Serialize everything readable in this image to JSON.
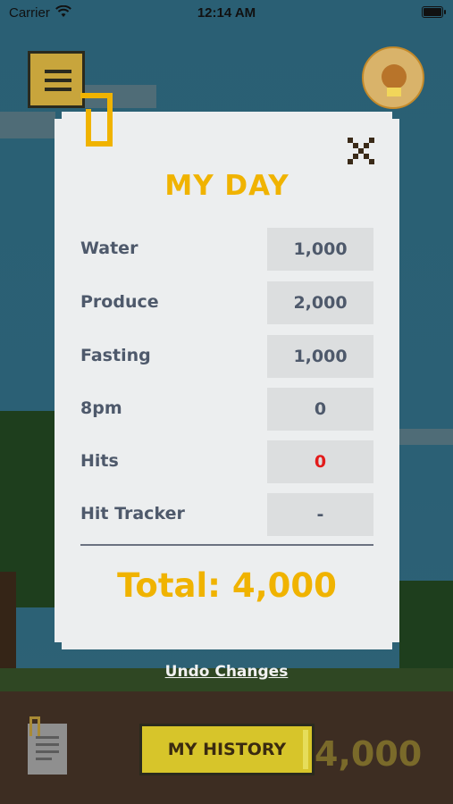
{
  "status_bar": {
    "carrier": "Carrier",
    "time": "12:14 AM"
  },
  "modal": {
    "title": "MY DAY",
    "rows": [
      {
        "label": "Water",
        "value": "1,000"
      },
      {
        "label": "Produce",
        "value": "2,000"
      },
      {
        "label": "Fasting",
        "value": "1,000"
      },
      {
        "label": "8pm",
        "value": "0"
      },
      {
        "label": "Hits",
        "value": "0"
      },
      {
        "label": "Hit Tracker",
        "value": "-"
      }
    ],
    "total": "Total: 4,000"
  },
  "undo_label": "Undo Changes",
  "history_button": "MY HISTORY",
  "bottom_total": "4,000",
  "colors": {
    "accent": "#f0b300",
    "hits_value": "#e21b1b",
    "label": "#4e596b"
  },
  "icons": [
    "wifi-icon",
    "battery-icon",
    "menu-icon",
    "avatar-icon",
    "bracket-icon",
    "close-icon",
    "history-document-icon"
  ]
}
